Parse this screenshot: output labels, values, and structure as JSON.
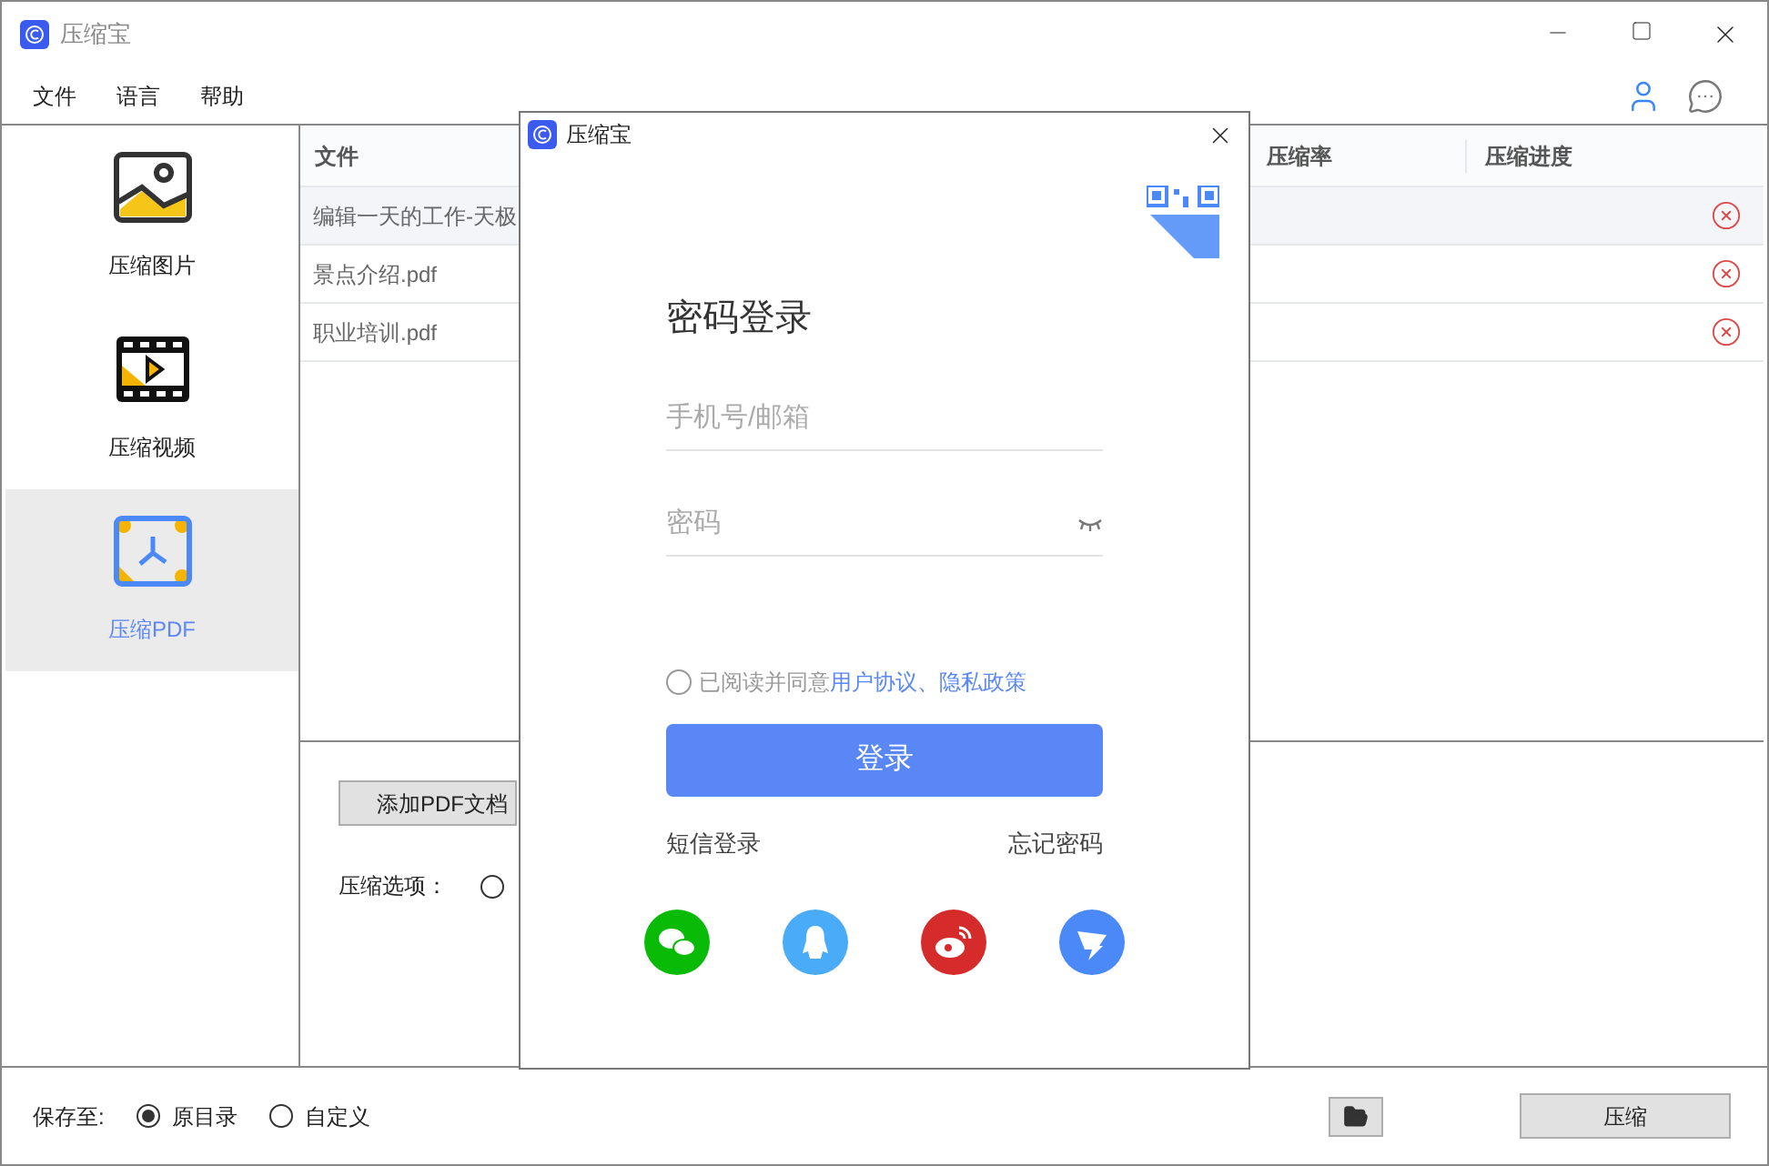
{
  "window": {
    "title": "压缩宝"
  },
  "menu": [
    "文件",
    "语言",
    "帮助"
  ],
  "sidebar": {
    "items": [
      {
        "kind": "image",
        "label": "压缩图片",
        "selected": false
      },
      {
        "kind": "video",
        "label": "压缩视频",
        "selected": false
      },
      {
        "kind": "pdf",
        "label": "压缩PDF",
        "selected": true
      }
    ]
  },
  "table": {
    "columns": [
      "文件",
      "压缩率",
      "压缩进度"
    ],
    "rows": [
      {
        "file": "编辑一天的工作-天极",
        "selected": true
      },
      {
        "file": "景点介绍.pdf",
        "selected": false
      },
      {
        "file": "职业培训.pdf",
        "selected": false
      }
    ]
  },
  "add_button": "添加PDF文档",
  "options_label": "压缩选项：",
  "option_radio": {
    "selected": false
  },
  "footer": {
    "label": "保存至:",
    "options": [
      {
        "label": "原目录",
        "selected": true
      },
      {
        "label": "自定义",
        "selected": false
      }
    ],
    "compress_button": "压缩"
  },
  "dialog": {
    "title": "压缩宝",
    "heading": "密码登录",
    "phone": {
      "placeholder": "手机号/邮箱"
    },
    "password": {
      "placeholder": "密码"
    },
    "agreement": {
      "checked": false,
      "prefix": "已阅读并同意",
      "links": [
        "用户协议",
        "隐私政策"
      ],
      "separator": "、"
    },
    "login_button": "登录",
    "sms_login": "短信登录",
    "forgot": "忘记密码",
    "social": [
      {
        "kind": "chat",
        "color": "#09bb07"
      },
      {
        "kind": "penguin",
        "color": "#4aacf9"
      },
      {
        "kind": "weibo",
        "color": "#d52b2b"
      },
      {
        "kind": "bird",
        "color": "#4a89f7"
      }
    ]
  }
}
